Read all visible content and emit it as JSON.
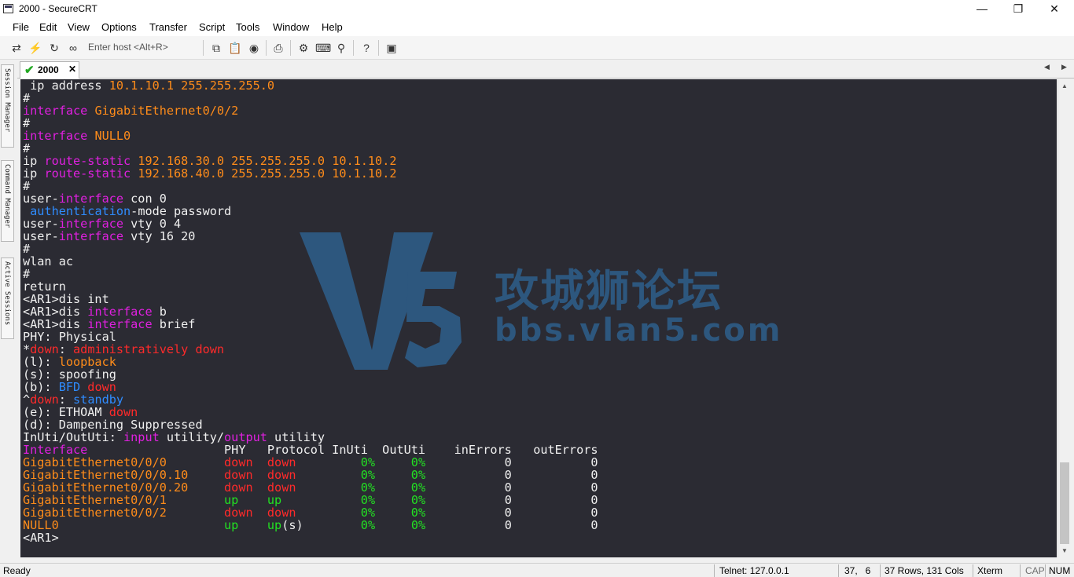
{
  "window": {
    "title": "2000 - SecureCRT"
  },
  "menu": [
    "File",
    "Edit",
    "View",
    "Options",
    "Transfer",
    "Script",
    "Tools",
    "Window",
    "Help"
  ],
  "toolbar": {
    "quick_connect_placeholder": "Enter host <Alt+R>"
  },
  "side_tabs": [
    "Session Manager",
    "Command Manager",
    "Active Sessions"
  ],
  "session_tab": {
    "label": "2000"
  },
  "terminal_lines": [
    [
      [
        "w",
        " ip address "
      ],
      [
        "o",
        "10.1.10.1 255.255.255.0"
      ]
    ],
    [
      [
        "w",
        "#"
      ]
    ],
    [
      [
        "m",
        "interface "
      ],
      [
        "o",
        "GigabitEthernet0/0/2"
      ]
    ],
    [
      [
        "w",
        "#"
      ]
    ],
    [
      [
        "m",
        "interface "
      ],
      [
        "o",
        "NULL0"
      ]
    ],
    [
      [
        "w",
        "#"
      ]
    ],
    [
      [
        "w",
        "ip "
      ],
      [
        "m",
        "route-static "
      ],
      [
        "o",
        "192.168.30.0 255.255.255.0 10.1.10.2"
      ]
    ],
    [
      [
        "w",
        "ip "
      ],
      [
        "m",
        "route-static "
      ],
      [
        "o",
        "192.168.40.0 255.255.255.0 10.1.10.2"
      ]
    ],
    [
      [
        "w",
        "#"
      ]
    ],
    [
      [
        "w",
        "user-"
      ],
      [
        "m",
        "interface"
      ],
      [
        "w",
        " con 0"
      ]
    ],
    [
      [
        "w",
        " "
      ],
      [
        "b",
        "authentication"
      ],
      [
        "w",
        "-mode password"
      ]
    ],
    [
      [
        "w",
        "user-"
      ],
      [
        "m",
        "interface"
      ],
      [
        "w",
        " vty 0 4"
      ]
    ],
    [
      [
        "w",
        "user-"
      ],
      [
        "m",
        "interface"
      ],
      [
        "w",
        " vty 16 20"
      ]
    ],
    [
      [
        "w",
        "#"
      ]
    ],
    [
      [
        "w",
        "wlan ac"
      ]
    ],
    [
      [
        "w",
        "#"
      ]
    ],
    [
      [
        "w",
        "return"
      ]
    ],
    [
      [
        "w",
        "<AR1>dis int"
      ]
    ],
    [
      [
        "w",
        "<AR1>dis "
      ],
      [
        "m",
        "interface"
      ],
      [
        "w",
        " b"
      ]
    ],
    [
      [
        "w",
        "<AR1>dis "
      ],
      [
        "m",
        "interface"
      ],
      [
        "w",
        " brief"
      ]
    ],
    [
      [
        "w",
        "PHY: Physical"
      ]
    ],
    [
      [
        "w",
        "*"
      ],
      [
        "r",
        "down"
      ],
      [
        "w",
        ": "
      ],
      [
        "r",
        "administratively down"
      ]
    ],
    [
      [
        "w",
        "(l): "
      ],
      [
        "o",
        "loopback"
      ]
    ],
    [
      [
        "w",
        "(s): spoofing"
      ]
    ],
    [
      [
        "w",
        "(b): "
      ],
      [
        "b",
        "BFD "
      ],
      [
        "r",
        "down"
      ]
    ],
    [
      [
        "w",
        "^"
      ],
      [
        "r",
        "down"
      ],
      [
        "w",
        ": "
      ],
      [
        "b",
        "standby"
      ]
    ],
    [
      [
        "w",
        "(e): ETHOAM "
      ],
      [
        "r",
        "down"
      ]
    ],
    [
      [
        "w",
        "(d): Dampening Suppressed"
      ]
    ],
    [
      [
        "w",
        "InUti/OutUti: "
      ],
      [
        "m",
        "input"
      ],
      [
        "w",
        " utility/"
      ],
      [
        "m",
        "output"
      ],
      [
        "w",
        " utility"
      ]
    ],
    [
      [
        "m",
        "Interface"
      ],
      [
        "w",
        "                   PHY   Protocol InUti  OutUti    inErrors   outErrors"
      ]
    ],
    [
      [
        "o",
        "GigabitEthernet0/0/0"
      ],
      [
        "w",
        "        "
      ],
      [
        "r",
        "down"
      ],
      [
        "w",
        "  "
      ],
      [
        "r",
        "down"
      ],
      [
        "w",
        "         "
      ],
      [
        "g",
        "0%"
      ],
      [
        "w",
        "     "
      ],
      [
        "g",
        "0%"
      ],
      [
        "w",
        "           0           0"
      ]
    ],
    [
      [
        "o",
        "GigabitEthernet0/0/0.10"
      ],
      [
        "w",
        "     "
      ],
      [
        "r",
        "down"
      ],
      [
        "w",
        "  "
      ],
      [
        "r",
        "down"
      ],
      [
        "w",
        "         "
      ],
      [
        "g",
        "0%"
      ],
      [
        "w",
        "     "
      ],
      [
        "g",
        "0%"
      ],
      [
        "w",
        "           0           0"
      ]
    ],
    [
      [
        "o",
        "GigabitEthernet0/0/0.20"
      ],
      [
        "w",
        "     "
      ],
      [
        "r",
        "down"
      ],
      [
        "w",
        "  "
      ],
      [
        "r",
        "down"
      ],
      [
        "w",
        "         "
      ],
      [
        "g",
        "0%"
      ],
      [
        "w",
        "     "
      ],
      [
        "g",
        "0%"
      ],
      [
        "w",
        "           0           0"
      ]
    ],
    [
      [
        "o",
        "GigabitEthernet0/0/1"
      ],
      [
        "w",
        "        "
      ],
      [
        "g",
        "up"
      ],
      [
        "w",
        "    "
      ],
      [
        "g",
        "up"
      ],
      [
        "w",
        "           "
      ],
      [
        "g",
        "0%"
      ],
      [
        "w",
        "     "
      ],
      [
        "g",
        "0%"
      ],
      [
        "w",
        "           0           0"
      ]
    ],
    [
      [
        "o",
        "GigabitEthernet0/0/2"
      ],
      [
        "w",
        "        "
      ],
      [
        "r",
        "down"
      ],
      [
        "w",
        "  "
      ],
      [
        "r",
        "down"
      ],
      [
        "w",
        "         "
      ],
      [
        "g",
        "0%"
      ],
      [
        "w",
        "     "
      ],
      [
        "g",
        "0%"
      ],
      [
        "w",
        "           0           0"
      ]
    ],
    [
      [
        "o",
        "NULL0"
      ],
      [
        "w",
        "                       "
      ],
      [
        "g",
        "up"
      ],
      [
        "w",
        "    "
      ],
      [
        "g",
        "up"
      ],
      [
        "w",
        "(s)        "
      ],
      [
        "g",
        "0%"
      ],
      [
        "w",
        "     "
      ],
      [
        "g",
        "0%"
      ],
      [
        "w",
        "           0           0"
      ]
    ],
    [
      [
        "w",
        "<AR1>"
      ]
    ]
  ],
  "watermark": {
    "brand": "攻城狮论坛",
    "url": "bbs.vlan5.com"
  },
  "status": {
    "ready": "Ready",
    "connection": "Telnet: 127.0.0.1",
    "cursor": "37,   6",
    "size": "37 Rows, 131 Cols",
    "terminal_type": "Xterm",
    "caps": "CAP",
    "num": "NUM"
  }
}
